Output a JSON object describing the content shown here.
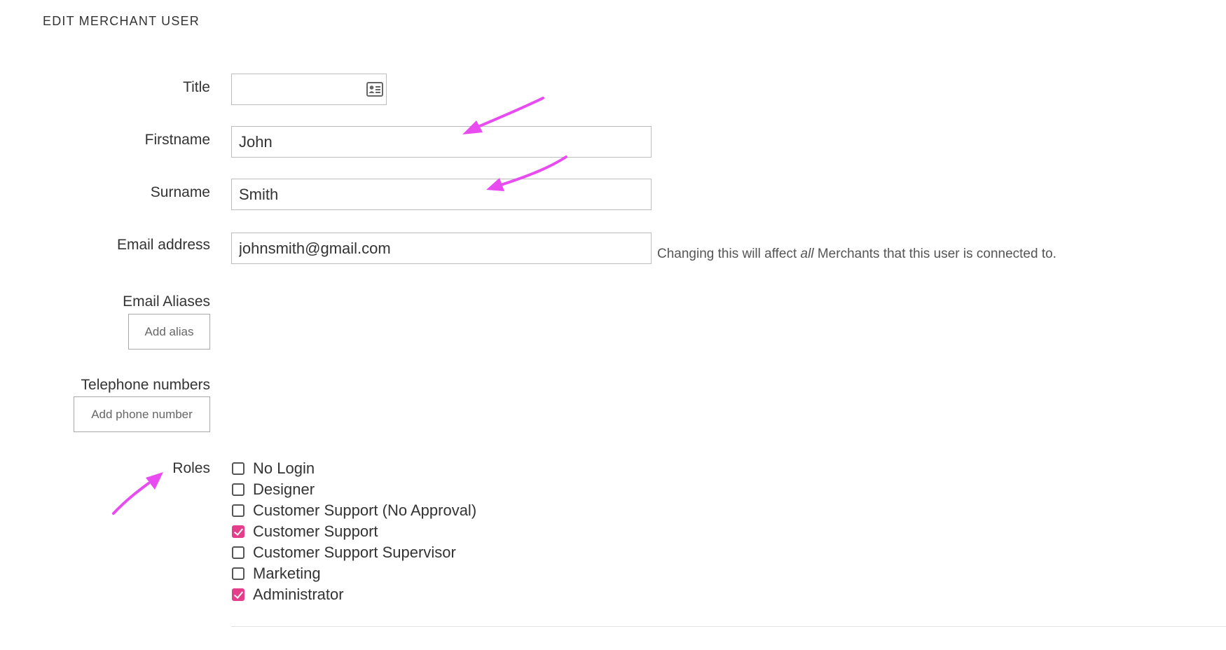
{
  "page": {
    "title": "EDIT MERCHANT USER"
  },
  "form": {
    "title_label": "Title",
    "title_value": "",
    "firstname_label": "Firstname",
    "firstname_value": "John",
    "surname_label": "Surname",
    "surname_value": "Smith",
    "email_label": "Email address",
    "email_value": "johnsmith@gmail.com",
    "email_help_before": "Changing this will affect ",
    "email_help_emphasis": "all",
    "email_help_after": " Merchants that this user is connected to.",
    "aliases_label": "Email Aliases",
    "add_alias_label": "Add alias",
    "phones_label": "Telephone numbers",
    "add_phone_label": "Add phone number",
    "roles_label": "Roles"
  },
  "roles": [
    {
      "label": "No Login",
      "checked": false
    },
    {
      "label": "Designer",
      "checked": false
    },
    {
      "label": "Customer Support (No Approval)",
      "checked": false
    },
    {
      "label": "Customer Support",
      "checked": true
    },
    {
      "label": "Customer Support Supervisor",
      "checked": false
    },
    {
      "label": "Marketing",
      "checked": false
    },
    {
      "label": "Administrator",
      "checked": true
    }
  ],
  "icons": {
    "title_field_icon": "contact-card-icon"
  },
  "colors": {
    "accent": "#e43e8b",
    "annotation_arrow": "#e84cf0"
  }
}
